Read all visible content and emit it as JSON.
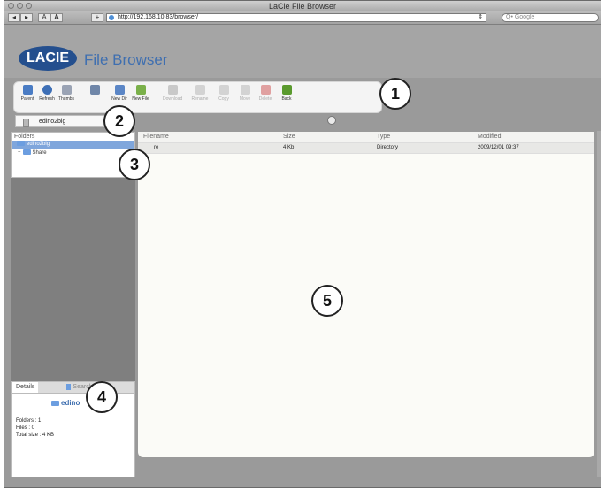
{
  "window": {
    "title": "LaCie File Browser"
  },
  "browser": {
    "url": "http://192.168.10.83/browser/",
    "search_placeholder": "Q• Google",
    "text_small": "A",
    "text_large": "A",
    "add_bookmark": "+",
    "reload": "¢"
  },
  "app": {
    "logo_text": "LACIE",
    "title": "File Browser"
  },
  "toolbar": {
    "items": [
      {
        "label": "Parent",
        "icon": "parent-icon",
        "color": "#4a7cc4",
        "enabled": true
      },
      {
        "label": "Refresh",
        "icon": "refresh-icon",
        "color": "#3d6fb6",
        "enabled": true
      },
      {
        "label": "Thumbs",
        "icon": "thumbs-icon",
        "color": "#9aa3b4",
        "enabled": true
      },
      {
        "label": "",
        "icon": "flask-icon",
        "color": "#6f86a8",
        "enabled": true
      },
      {
        "label": "New Dir",
        "icon": "new-dir-icon",
        "color": "#5b86c6",
        "enabled": true
      },
      {
        "label": "New File",
        "icon": "new-file-icon",
        "color": "#7ab04a",
        "enabled": true
      },
      {
        "label": "Download",
        "icon": "download-icon",
        "color": "#c9c9c9",
        "enabled": false
      },
      {
        "label": "Rename",
        "icon": "rename-icon",
        "color": "#d3d3d3",
        "enabled": false
      },
      {
        "label": "Copy",
        "icon": "copy-icon",
        "color": "#d3d3d3",
        "enabled": false
      },
      {
        "label": "Move",
        "icon": "move-icon",
        "color": "#d3d3d3",
        "enabled": false
      },
      {
        "label": "Delete",
        "icon": "delete-icon",
        "color": "#e0a0a0",
        "enabled": false
      },
      {
        "label": "Back",
        "icon": "back-icon",
        "color": "#5a9a2e",
        "enabled": true
      }
    ]
  },
  "selector": {
    "value": "edino2big"
  },
  "folders": {
    "header": "Folders",
    "root": "edino2big",
    "children": [
      "Share"
    ]
  },
  "details": {
    "tab_details": "Details",
    "tab_search": "Search",
    "name": "edino",
    "folders_line": "Folders : 1",
    "files_line": "Files : 0",
    "size_line": "Total size : 4 KB"
  },
  "table": {
    "columns": [
      "Filename",
      "Size",
      "Type",
      "Modified"
    ],
    "rows": [
      {
        "filename": "re",
        "size": "4 Kb",
        "type": "Directory",
        "modified": "2009/12/01 09:37"
      }
    ]
  },
  "callouts": [
    "1",
    "2",
    "3",
    "4",
    "5"
  ]
}
